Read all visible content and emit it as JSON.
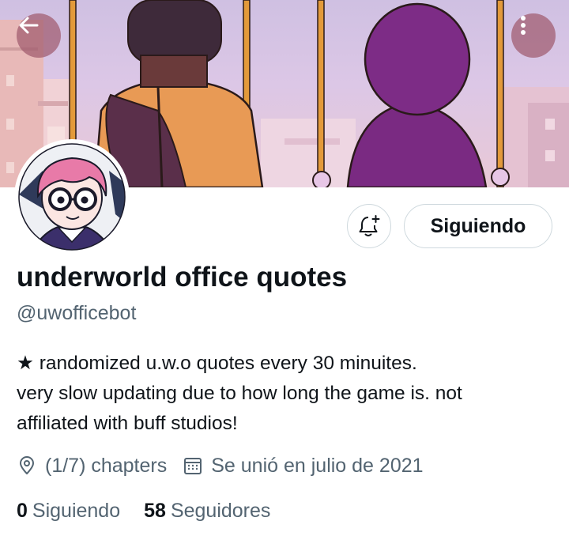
{
  "header": {
    "back_icon": "arrow-left-icon",
    "more_icon": "more-vertical-icon"
  },
  "profile": {
    "display_name": "underworld office quotes",
    "handle": "@uwofficebot",
    "bio_lines": [
      "★ randomized u.w.o quotes every 30 minuites.",
      "very slow updating due to how long the game is. not",
      "affiliated with buff studios!"
    ],
    "location": "(1/7) chapters",
    "joined": "Se unió en julio de 2021",
    "following_count": "0",
    "following_label": "Siguiendo",
    "followers_count": "58",
    "followers_label": "Seguidores"
  },
  "actions": {
    "notify_icon": "bell-plus-icon",
    "follow_label": "Siguiendo"
  },
  "colors": {
    "text_primary": "#0f1419",
    "text_secondary": "#536471",
    "border": "#cfd9de",
    "overlay_button": "#a05a6e"
  }
}
